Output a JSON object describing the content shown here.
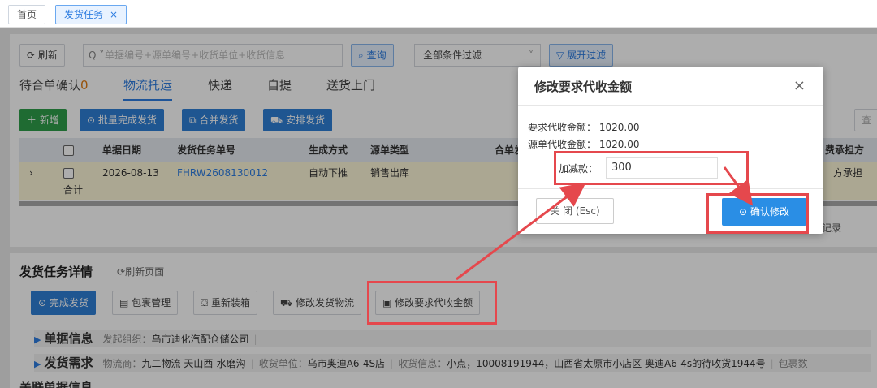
{
  "top_tabs": [
    {
      "label": "首页"
    },
    {
      "label": "发货任务",
      "close": "×"
    }
  ],
  "toolbar": {
    "refresh": "刷新",
    "search_placeholder": "单据编号+源单编号+收货单位+收货信息",
    "query": "查询",
    "filter_select": "全部条件过滤",
    "expand_filter": "展开过滤"
  },
  "sub_tabs": [
    {
      "label": "待合单确认",
      "count": "0"
    },
    {
      "label": "物流托运",
      "active": true
    },
    {
      "label": "快递"
    },
    {
      "label": "自提"
    },
    {
      "label": "送货上门"
    }
  ],
  "actions": {
    "add": "新增",
    "batch_complete": "批量完成发货",
    "merge": "合并发货",
    "arrange": "安排发货"
  },
  "table": {
    "headers": [
      "单据日期",
      "发货任务单号",
      "生成方式",
      "源单类型",
      "合单发",
      "费承担方"
    ],
    "row": {
      "date": "2026-08-13",
      "task_no": "FHRW2608130012",
      "method": "自动下推",
      "source_type": "销售出库",
      "cost_bearer": "方承担"
    },
    "sum_label": "合计",
    "right_partial": "查",
    "records_partial": "记录"
  },
  "detail": {
    "title": "发货任务详情",
    "refresh": "刷新页面",
    "buttons": [
      "完成发货",
      "包裹管理",
      "重新装箱",
      "修改发货物流",
      "修改要求代收金额"
    ],
    "doc_info": {
      "label": "单据信息",
      "org_label": "发起组织：",
      "org_value": "乌市迪化汽配仓储公司"
    },
    "ship_req": {
      "label": "发货需求",
      "logistics_label": "物流商：",
      "logistics_value": "九二物流 天山西-水磨沟",
      "receiver_label": "收货单位：",
      "receiver_value": "乌市奥迪A6-4S店",
      "info_label": "收货信息：",
      "info_value": "小点，10008191944，山西省太原市小店区 奥迪A6-4s的待收货1944号",
      "package_label": "包裹数"
    },
    "related": "关联单据信息"
  },
  "modal": {
    "title": "修改要求代收金额",
    "close_icon": "×",
    "required_label": "要求代收金额：",
    "required_value": "1020.00",
    "source_label": "源单代收金额：",
    "source_value": "1020.00",
    "adjust_label": "加减款：",
    "adjust_value": "300",
    "close_btn": "关 闭 (Esc)",
    "confirm_btn": "确认修改"
  },
  "colors": {
    "primary": "#2d7ce0",
    "green": "#2e9e4a",
    "highlight": "#e5484d",
    "row_yellow": "#fdf6d8"
  }
}
